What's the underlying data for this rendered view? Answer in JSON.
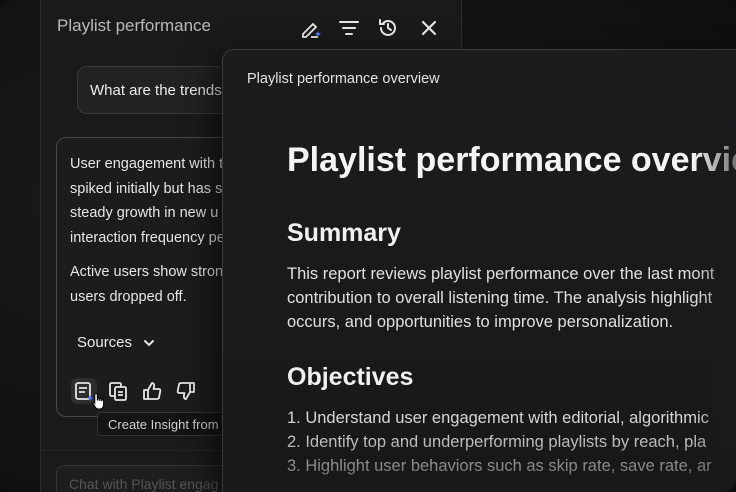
{
  "chat": {
    "title": "Playlist performance",
    "header_icons": [
      "edit-sparkle-icon",
      "filter-icon",
      "history-icon",
      "close-icon"
    ],
    "prompt": "What are the trends",
    "answer": {
      "p1_l1": "User engagement with t",
      "p1_l2": "spiked initially but has s",
      "p1_l3": "steady growth in new u",
      "p1_l4": "interaction frequency pe",
      "p2_l1": "Active users show stron",
      "p2_l2": "users dropped off."
    },
    "sources_label": "Sources",
    "action_icons": [
      "create-insight-icon",
      "copy-icon",
      "thumbs-up-icon",
      "thumbs-down-icon"
    ],
    "tooltip": "Create Insight from chat",
    "input_placeholder": "Chat with Playlist engag"
  },
  "doc": {
    "bar_title": "Playlist performance overview",
    "h1": "Playlist performance overvie",
    "summary_heading": "Summary",
    "summary_l1": "This report reviews playlist performance over the last mont",
    "summary_l2": "contribution to overall listening time. The analysis highlight",
    "summary_l3": "occurs, and opportunities to improve personalization.",
    "objectives_heading": "Objectives",
    "objectives": [
      "1. Understand user engagement with editorial, algorithmic",
      "2. Identify top and underperforming playlists by reach, pla",
      "3. Highlight user behaviors such as skip rate, save rate, ar"
    ]
  },
  "colors": {
    "background": "#111112",
    "panel": "#1a1a1b",
    "accent": "#4f7cff"
  }
}
